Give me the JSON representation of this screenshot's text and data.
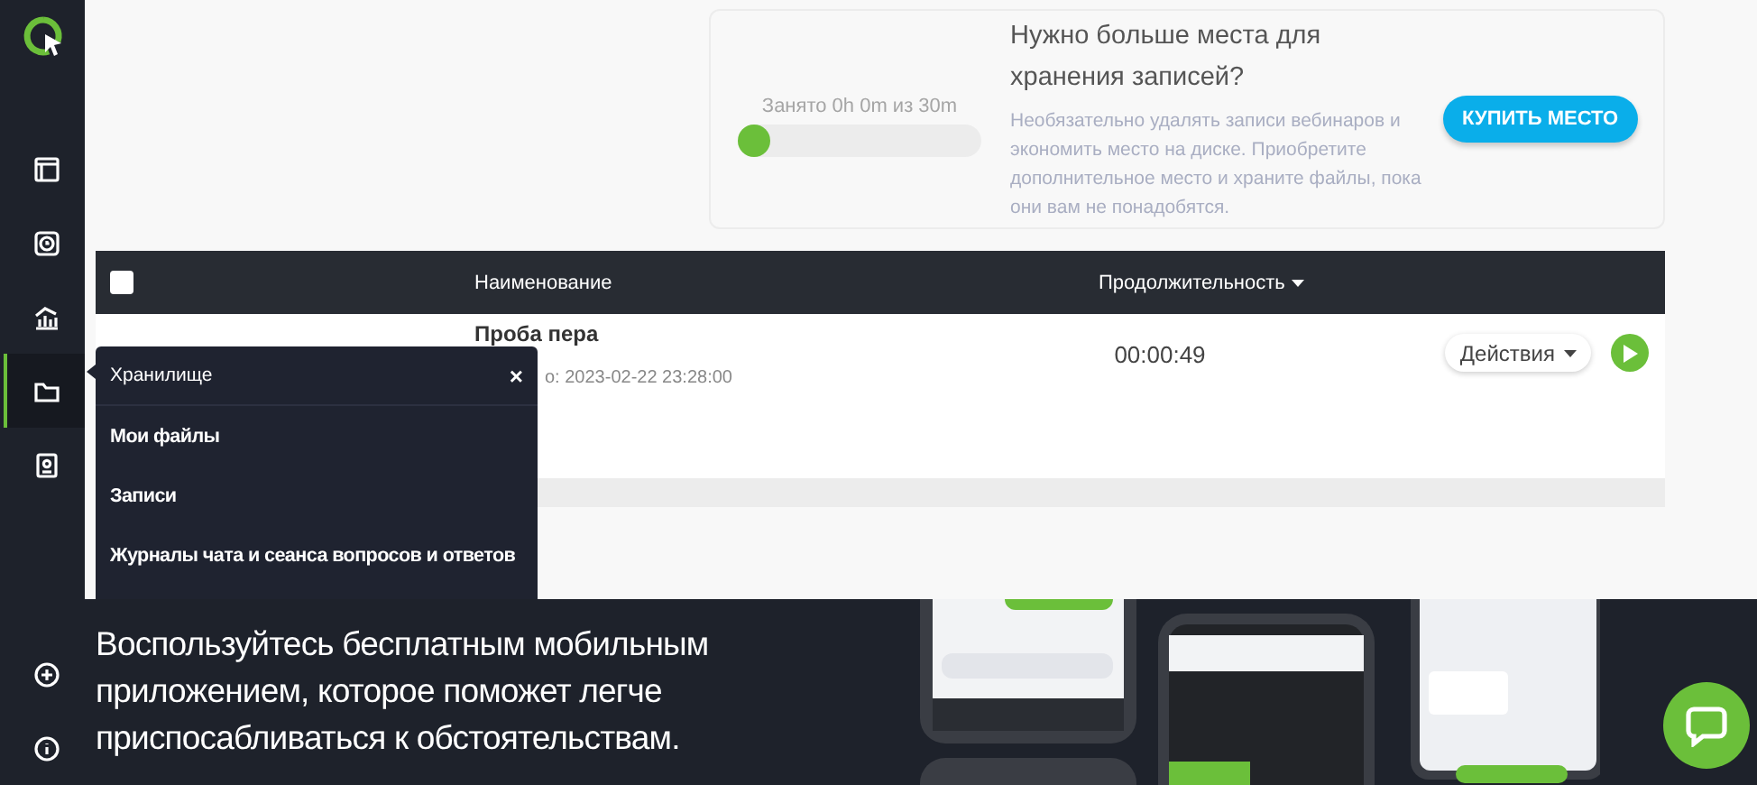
{
  "sidebar": {
    "items": [
      {
        "kind": "layout",
        "selected": false
      },
      {
        "kind": "record",
        "selected": false
      },
      {
        "kind": "chart",
        "selected": false
      },
      {
        "kind": "folder",
        "selected": true
      },
      {
        "kind": "contacts",
        "selected": false
      }
    ],
    "bottom_items": [
      {
        "kind": "plus"
      },
      {
        "kind": "info"
      }
    ]
  },
  "storage": {
    "usage_label": "Занято 0h 0m из 30m",
    "level": 0.04,
    "title": "Нужно больше места для хранения записей?",
    "description": "Необязательно удалять записи вебинаров и экономить место на диске. Приобретите дополнительное место и храните файлы, пока они вам не понадобятся.",
    "button": "КУПИТЬ МЕСТО"
  },
  "table": {
    "select_all": {
      "checked": false
    },
    "columns": [
      {
        "label": "Наименование",
        "sortable": false
      },
      {
        "label": "Продолжительность",
        "sortable": true
      }
    ],
    "rows": [
      {
        "title": "Проба пера",
        "date": "о: 2023-02-22 23:28:00",
        "duration": "00:00:49",
        "actions": "Действия"
      }
    ]
  },
  "popup": {
    "title": "Хранилище",
    "close": "×",
    "items": [
      "Мои файлы",
      "Записи",
      "Журналы чата и сеанса вопросов и ответов"
    ]
  },
  "banner": {
    "text": "Воспользуйтесь бесплатным мобильным приложением, которое поможет легче приспосабливаться к обстоятельствам."
  }
}
